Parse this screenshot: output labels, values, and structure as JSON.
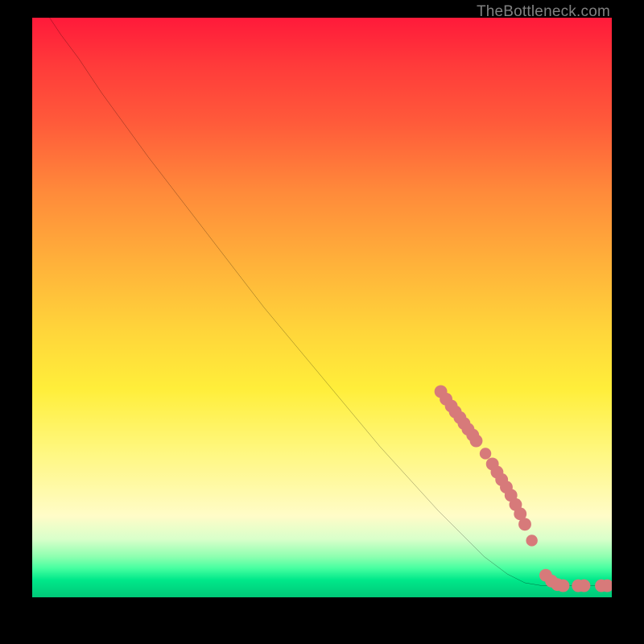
{
  "watermark": "TheBottleneck.com",
  "colors": {
    "point_fill": "#d77a7a",
    "curve_stroke": "#000000",
    "frame": "#000000"
  },
  "chart_data": {
    "type": "line",
    "title": "",
    "xlabel": "",
    "ylabel": "",
    "xlim": [
      0,
      100
    ],
    "ylim": [
      0,
      100
    ],
    "curve": [
      {
        "x": 3,
        "y": 100
      },
      {
        "x": 5,
        "y": 97
      },
      {
        "x": 8,
        "y": 93
      },
      {
        "x": 12,
        "y": 87
      },
      {
        "x": 20,
        "y": 76
      },
      {
        "x": 30,
        "y": 63
      },
      {
        "x": 40,
        "y": 50
      },
      {
        "x": 50,
        "y": 38
      },
      {
        "x": 60,
        "y": 26
      },
      {
        "x": 70,
        "y": 15
      },
      {
        "x": 78,
        "y": 7
      },
      {
        "x": 82,
        "y": 4
      },
      {
        "x": 85,
        "y": 2.5
      },
      {
        "x": 88,
        "y": 2
      },
      {
        "x": 92,
        "y": 2
      },
      {
        "x": 96,
        "y": 2
      },
      {
        "x": 100,
        "y": 2
      }
    ],
    "points": [
      {
        "x": 70.5,
        "y": 35.5,
        "r": 1.1
      },
      {
        "x": 71.4,
        "y": 34.2,
        "r": 1.1
      },
      {
        "x": 72.3,
        "y": 33.0,
        "r": 1.1
      },
      {
        "x": 73.0,
        "y": 32.0,
        "r": 1.1
      },
      {
        "x": 73.8,
        "y": 31.0,
        "r": 1.1
      },
      {
        "x": 74.5,
        "y": 30.0,
        "r": 1.1
      },
      {
        "x": 75.2,
        "y": 29.0,
        "r": 1.1
      },
      {
        "x": 76.0,
        "y": 28.0,
        "r": 1.1
      },
      {
        "x": 76.6,
        "y": 27.0,
        "r": 1.1
      },
      {
        "x": 78.2,
        "y": 24.8,
        "r": 1.0
      },
      {
        "x": 79.4,
        "y": 23.0,
        "r": 1.1
      },
      {
        "x": 80.2,
        "y": 21.6,
        "r": 1.1
      },
      {
        "x": 81.0,
        "y": 20.3,
        "r": 1.1
      },
      {
        "x": 81.8,
        "y": 19.0,
        "r": 1.1
      },
      {
        "x": 82.6,
        "y": 17.6,
        "r": 1.1
      },
      {
        "x": 83.4,
        "y": 16.0,
        "r": 1.1
      },
      {
        "x": 84.2,
        "y": 14.4,
        "r": 1.1
      },
      {
        "x": 85.0,
        "y": 12.6,
        "r": 1.1
      },
      {
        "x": 86.2,
        "y": 9.8,
        "r": 1.0
      },
      {
        "x": 88.6,
        "y": 3.8,
        "r": 1.1
      },
      {
        "x": 89.6,
        "y": 2.8,
        "r": 1.1
      },
      {
        "x": 90.6,
        "y": 2.2,
        "r": 1.1
      },
      {
        "x": 91.6,
        "y": 2.0,
        "r": 1.1
      },
      {
        "x": 94.2,
        "y": 2.0,
        "r": 1.1
      },
      {
        "x": 95.2,
        "y": 2.0,
        "r": 1.1
      },
      {
        "x": 98.2,
        "y": 2.0,
        "r": 1.1
      },
      {
        "x": 99.2,
        "y": 2.0,
        "r": 1.1
      }
    ]
  }
}
